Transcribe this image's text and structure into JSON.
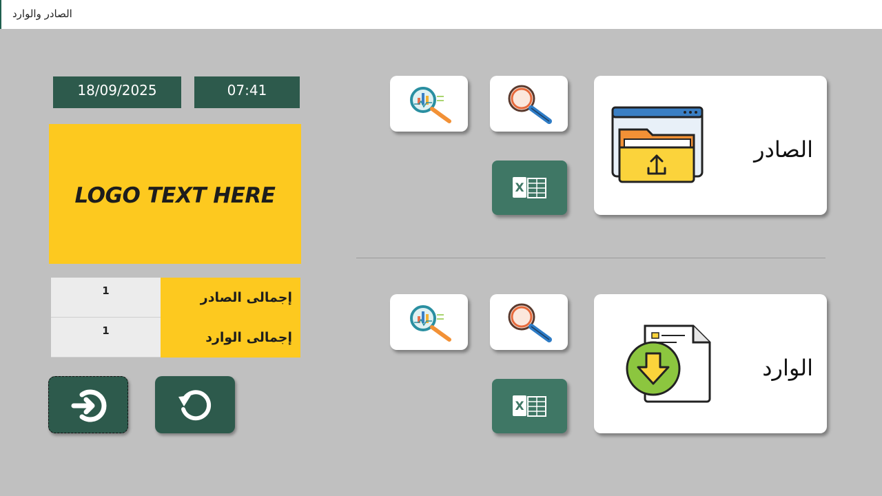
{
  "window": {
    "title": "الصادر والوارد"
  },
  "header": {
    "date": "18/09/2025",
    "time": "07:41"
  },
  "logo": {
    "text": "LOGO TEXT HERE"
  },
  "totals": [
    {
      "label": "إجمالى الصادر",
      "value": "1"
    },
    {
      "label": "إجمالى الوارد",
      "value": "1"
    }
  ],
  "outgoing": {
    "label": "الصادر"
  },
  "incoming": {
    "label": "الوارد"
  },
  "icons": {
    "outgoing_main": "folder-upload-icon",
    "incoming_main": "document-download-icon",
    "search": "magnifier-icon",
    "analytics": "analytics-search-icon",
    "excel": "excel-icon",
    "exit": "exit-icon",
    "refresh": "refresh-icon"
  },
  "colors": {
    "accent_green": "#2d5a4c",
    "excel_green": "#3f7765",
    "logo_yellow": "#fdc91f",
    "background": "#c0c0c0"
  }
}
